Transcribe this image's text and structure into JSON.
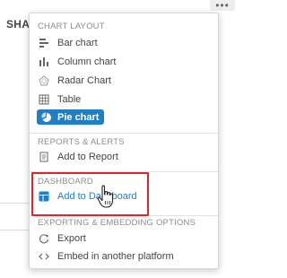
{
  "background": {
    "header_fragment": "SHA",
    "more_button_label": "•••"
  },
  "menu": {
    "sections": {
      "chart_layout": "CHART LAYOUT",
      "reports_alerts": "REPORTS & ALERTS",
      "dashboard": "DASHBOARD",
      "exporting": "EXPORTING & EMBEDDING OPTIONS"
    },
    "items": {
      "bar_chart": "Bar chart",
      "column_chart": "Column chart",
      "radar_chart": "Radar Chart",
      "table": "Table",
      "pie_chart": "Pie chart",
      "add_to_report": "Add to Report",
      "add_to_dashboard": "Add to Dashboard",
      "export": "Export",
      "embed": "Embed in another platform"
    },
    "selected_item": "pie_chart"
  },
  "colors": {
    "accent": "#1f7fc2",
    "highlight": "#d7282f",
    "section_text": "#8c8c8c"
  }
}
